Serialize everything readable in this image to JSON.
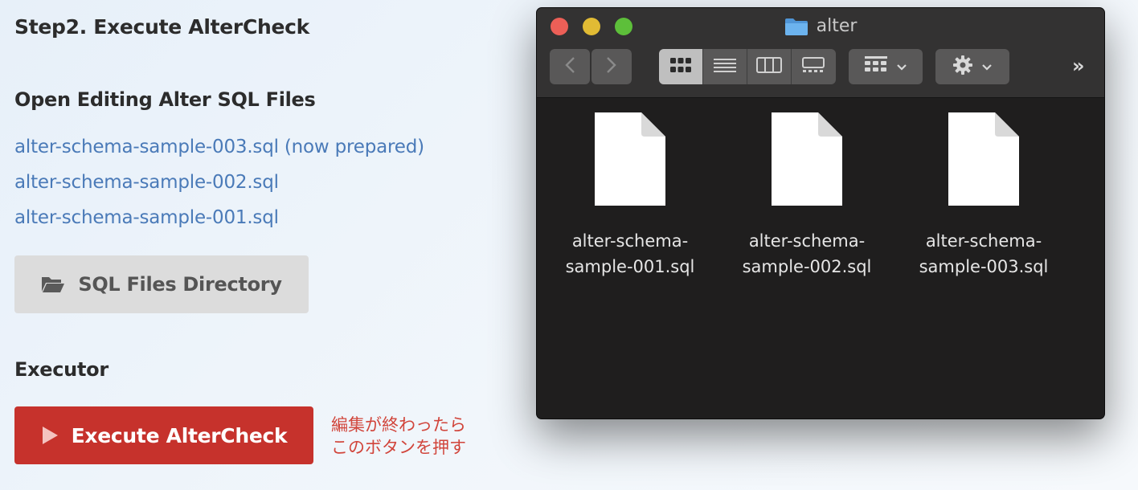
{
  "left_panel": {
    "step_title": "Step2. Execute AlterCheck",
    "open_section_title": "Open Editing Alter SQL Files",
    "sql_files": [
      {
        "label": "alter-schema-sample-003.sql (now prepared)"
      },
      {
        "label": "alter-schema-sample-002.sql"
      },
      {
        "label": "alter-schema-sample-001.sql"
      }
    ],
    "directory_button": {
      "label": "SQL Files Directory",
      "icon": "folder-open-icon"
    },
    "executor_title": "Executor",
    "execute_button": {
      "label": "Execute AlterCheck",
      "icon": "play-icon"
    },
    "execute_note": "編集が終わったら\nこのボタンを押す"
  },
  "finder": {
    "title": "alter",
    "toolbar": {
      "back_icon": "chevron-left-icon",
      "forward_icon": "chevron-right-icon",
      "view_modes": [
        "icon-view-icon",
        "list-view-icon",
        "column-view-icon",
        "gallery-view-icon"
      ],
      "active_view": "icon-view-icon",
      "group_icon": "group-grid-icon",
      "action_icon": "gear-icon",
      "overflow_label": "»"
    },
    "files": [
      {
        "label": "alter-schema-sample-001.sql"
      },
      {
        "label": "alter-schema-sample-002.sql"
      },
      {
        "label": "alter-schema-sample-003.sql"
      }
    ]
  },
  "colors": {
    "link": "#4a7ab8",
    "execute_button": "#c6322c",
    "note_text": "#d1453b",
    "directory_button": "#dcdcdc",
    "finder_background": "#1f1e1e",
    "folder_icon": "#5aa5e6"
  }
}
